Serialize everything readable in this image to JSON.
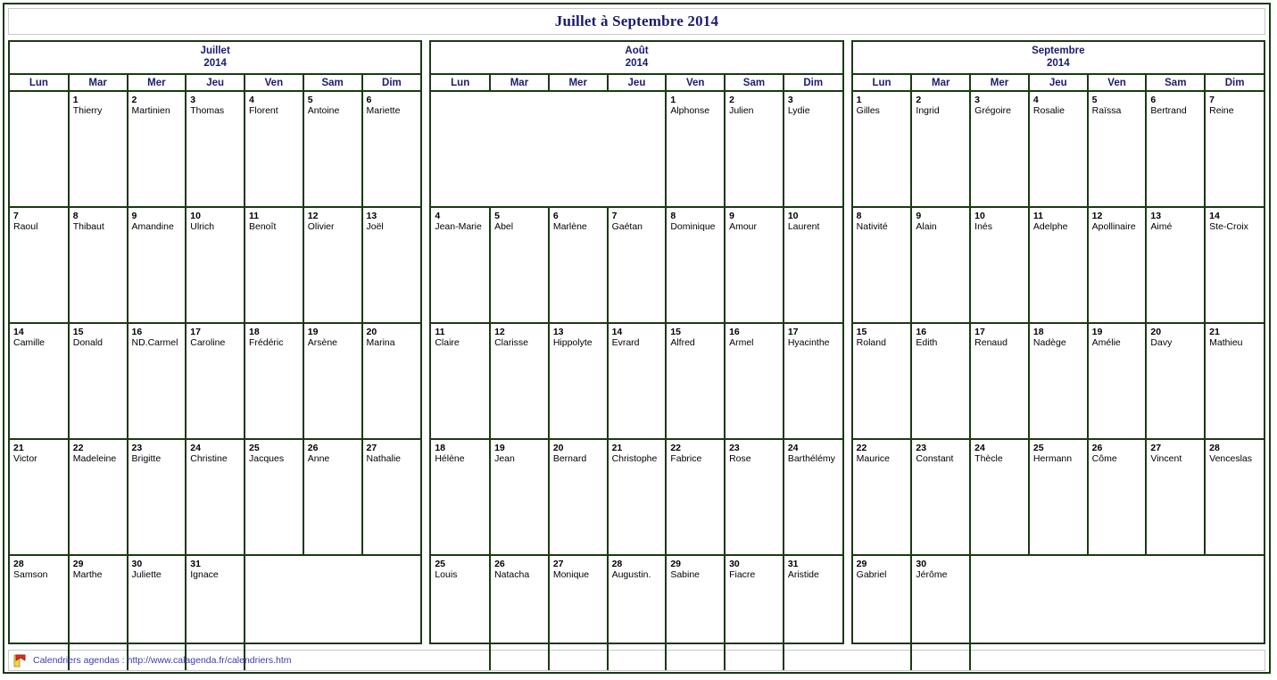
{
  "title": "Juillet à Septembre 2014",
  "weekdays": [
    "Lun",
    "Mar",
    "Mer",
    "Jeu",
    "Ven",
    "Sam",
    "Dim"
  ],
  "colors": {
    "border": "#1a3a13",
    "heading_text": "#1b1b6e",
    "link_text": "#3b3bb0",
    "day_text": "#000000",
    "background": "#ffffff"
  },
  "footer": {
    "icon": "flag-bookmark-icon",
    "text": "Calendriers agendas : http://www.calagenda.fr/calendriers.htm"
  },
  "months": [
    {
      "name": "Juillet",
      "year": "2014",
      "weeks": [
        [
          {
            "day": "",
            "saint": ""
          },
          {
            "day": "1",
            "saint": "Thierry"
          },
          {
            "day": "2",
            "saint": "Martinien"
          },
          {
            "day": "3",
            "saint": "Thomas"
          },
          {
            "day": "4",
            "saint": "Florent"
          },
          {
            "day": "5",
            "saint": "Antoine"
          },
          {
            "day": "6",
            "saint": "Mariette"
          }
        ],
        [
          {
            "day": "7",
            "saint": "Raoul"
          },
          {
            "day": "8",
            "saint": "Thibaut"
          },
          {
            "day": "9",
            "saint": "Amandine"
          },
          {
            "day": "10",
            "saint": "Ulrich"
          },
          {
            "day": "11",
            "saint": "Benoît"
          },
          {
            "day": "12",
            "saint": "Olivier"
          },
          {
            "day": "13",
            "saint": "Joël"
          }
        ],
        [
          {
            "day": "14",
            "saint": "Camille"
          },
          {
            "day": "15",
            "saint": "Donald"
          },
          {
            "day": "16",
            "saint": "ND.Carmel"
          },
          {
            "day": "17",
            "saint": "Caroline"
          },
          {
            "day": "18",
            "saint": "Frédéric"
          },
          {
            "day": "19",
            "saint": "Arsène"
          },
          {
            "day": "20",
            "saint": "Marina"
          }
        ],
        [
          {
            "day": "21",
            "saint": "Victor"
          },
          {
            "day": "22",
            "saint": "Madeleine"
          },
          {
            "day": "23",
            "saint": "Brigitte"
          },
          {
            "day": "24",
            "saint": "Christine"
          },
          {
            "day": "25",
            "saint": "Jacques"
          },
          {
            "day": "26",
            "saint": "Anne"
          },
          {
            "day": "27",
            "saint": "Nathalie"
          }
        ],
        [
          {
            "day": "28",
            "saint": "Samson"
          },
          {
            "day": "29",
            "saint": "Marthe"
          },
          {
            "day": "30",
            "saint": "Juliette"
          },
          {
            "day": "31",
            "saint": "Ignace"
          },
          {
            "day": "",
            "saint": ""
          },
          {
            "day": "",
            "saint": ""
          },
          {
            "day": "",
            "saint": ""
          }
        ]
      ]
    },
    {
      "name": "Août",
      "year": "2014",
      "weeks": [
        [
          {
            "day": "",
            "saint": ""
          },
          {
            "day": "",
            "saint": ""
          },
          {
            "day": "",
            "saint": ""
          },
          {
            "day": "",
            "saint": ""
          },
          {
            "day": "1",
            "saint": "Alphonse"
          },
          {
            "day": "2",
            "saint": "Julien"
          },
          {
            "day": "3",
            "saint": "Lydie"
          }
        ],
        [
          {
            "day": "4",
            "saint": "Jean-Marie"
          },
          {
            "day": "5",
            "saint": "Abel"
          },
          {
            "day": "6",
            "saint": "Marlène"
          },
          {
            "day": "7",
            "saint": "Gaétan"
          },
          {
            "day": "8",
            "saint": "Dominique"
          },
          {
            "day": "9",
            "saint": "Amour"
          },
          {
            "day": "10",
            "saint": "Laurent"
          }
        ],
        [
          {
            "day": "11",
            "saint": "Claire"
          },
          {
            "day": "12",
            "saint": "Clarisse"
          },
          {
            "day": "13",
            "saint": "Hippolyte"
          },
          {
            "day": "14",
            "saint": "Evrard"
          },
          {
            "day": "15",
            "saint": "Alfred"
          },
          {
            "day": "16",
            "saint": "Armel"
          },
          {
            "day": "17",
            "saint": "Hyacinthe"
          }
        ],
        [
          {
            "day": "18",
            "saint": "Hélène"
          },
          {
            "day": "19",
            "saint": "Jean"
          },
          {
            "day": "20",
            "saint": "Bernard"
          },
          {
            "day": "21",
            "saint": "Christophe"
          },
          {
            "day": "22",
            "saint": "Fabrice"
          },
          {
            "day": "23",
            "saint": "Rose"
          },
          {
            "day": "24",
            "saint": "Barthélémy"
          }
        ],
        [
          {
            "day": "25",
            "saint": "Louis"
          },
          {
            "day": "26",
            "saint": "Natacha"
          },
          {
            "day": "27",
            "saint": "Monique"
          },
          {
            "day": "28",
            "saint": "Augustin."
          },
          {
            "day": "29",
            "saint": "Sabine"
          },
          {
            "day": "30",
            "saint": "Fiacre"
          },
          {
            "day": "31",
            "saint": "Aristide"
          }
        ]
      ]
    },
    {
      "name": "Septembre",
      "year": "2014",
      "weeks": [
        [
          {
            "day": "1",
            "saint": "Gilles"
          },
          {
            "day": "2",
            "saint": "Ingrid"
          },
          {
            "day": "3",
            "saint": "Grégoire"
          },
          {
            "day": "4",
            "saint": "Rosalie"
          },
          {
            "day": "5",
            "saint": "Raïssa"
          },
          {
            "day": "6",
            "saint": "Bertrand"
          },
          {
            "day": "7",
            "saint": "Reine"
          }
        ],
        [
          {
            "day": "8",
            "saint": "Nativité"
          },
          {
            "day": "9",
            "saint": "Alain"
          },
          {
            "day": "10",
            "saint": "Inés"
          },
          {
            "day": "11",
            "saint": "Adelphe"
          },
          {
            "day": "12",
            "saint": "Apollinaire"
          },
          {
            "day": "13",
            "saint": "Aimé"
          },
          {
            "day": "14",
            "saint": "Ste-Croix"
          }
        ],
        [
          {
            "day": "15",
            "saint": "Roland"
          },
          {
            "day": "16",
            "saint": "Edith"
          },
          {
            "day": "17",
            "saint": "Renaud"
          },
          {
            "day": "18",
            "saint": "Nadège"
          },
          {
            "day": "19",
            "saint": "Amélie"
          },
          {
            "day": "20",
            "saint": "Davy"
          },
          {
            "day": "21",
            "saint": "Mathieu"
          }
        ],
        [
          {
            "day": "22",
            "saint": "Maurice"
          },
          {
            "day": "23",
            "saint": "Constant"
          },
          {
            "day": "24",
            "saint": "Thècle"
          },
          {
            "day": "25",
            "saint": "Hermann"
          },
          {
            "day": "26",
            "saint": "Côme"
          },
          {
            "day": "27",
            "saint": "Vincent"
          },
          {
            "day": "28",
            "saint": "Venceslas"
          }
        ],
        [
          {
            "day": "29",
            "saint": "Gabriel"
          },
          {
            "day": "30",
            "saint": "Jérôme"
          },
          {
            "day": "",
            "saint": ""
          },
          {
            "day": "",
            "saint": ""
          },
          {
            "day": "",
            "saint": ""
          },
          {
            "day": "",
            "saint": ""
          },
          {
            "day": "",
            "saint": ""
          }
        ]
      ]
    }
  ]
}
